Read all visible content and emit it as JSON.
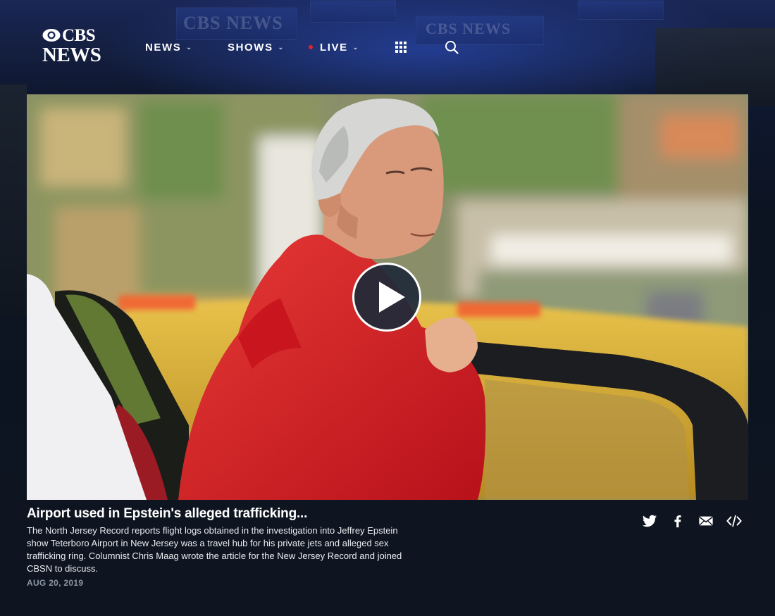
{
  "header": {
    "logo_line1": "CBS",
    "logo_line2": "NEWS",
    "nav": [
      {
        "label": "NEWS",
        "has_dropdown": true
      },
      {
        "label": "SHOWS",
        "has_dropdown": true
      },
      {
        "label": "LIVE",
        "has_dropdown": true,
        "live_indicator": true
      }
    ],
    "icons": [
      "sections-grid-icon",
      "search-icon"
    ]
  },
  "video": {
    "play_icon": "play-icon",
    "headline": "Airport used in Epstein's alleged trafficking...",
    "summary": "The North Jersey Record reports flight logs obtained in the investigation into Jeffrey Epstein show Teterboro Airport in New Jersey was a travel hub for his private jets and alleged sex trafficking ring. Columnist Chris Maag wrote the article for the New Jersey Record and joined CBSN to discuss.",
    "date": "AUG 20, 2019"
  },
  "share": [
    "twitter-icon",
    "facebook-icon",
    "email-icon",
    "embed-icon"
  ],
  "colors": {
    "live_dot": "#e0242b",
    "page_background": "#0f1620",
    "play_button": "#1e2a3a",
    "date_text": "#8a95a3"
  },
  "backdrop_text": [
    "CBS NEWS",
    "CBS NEWS"
  ]
}
